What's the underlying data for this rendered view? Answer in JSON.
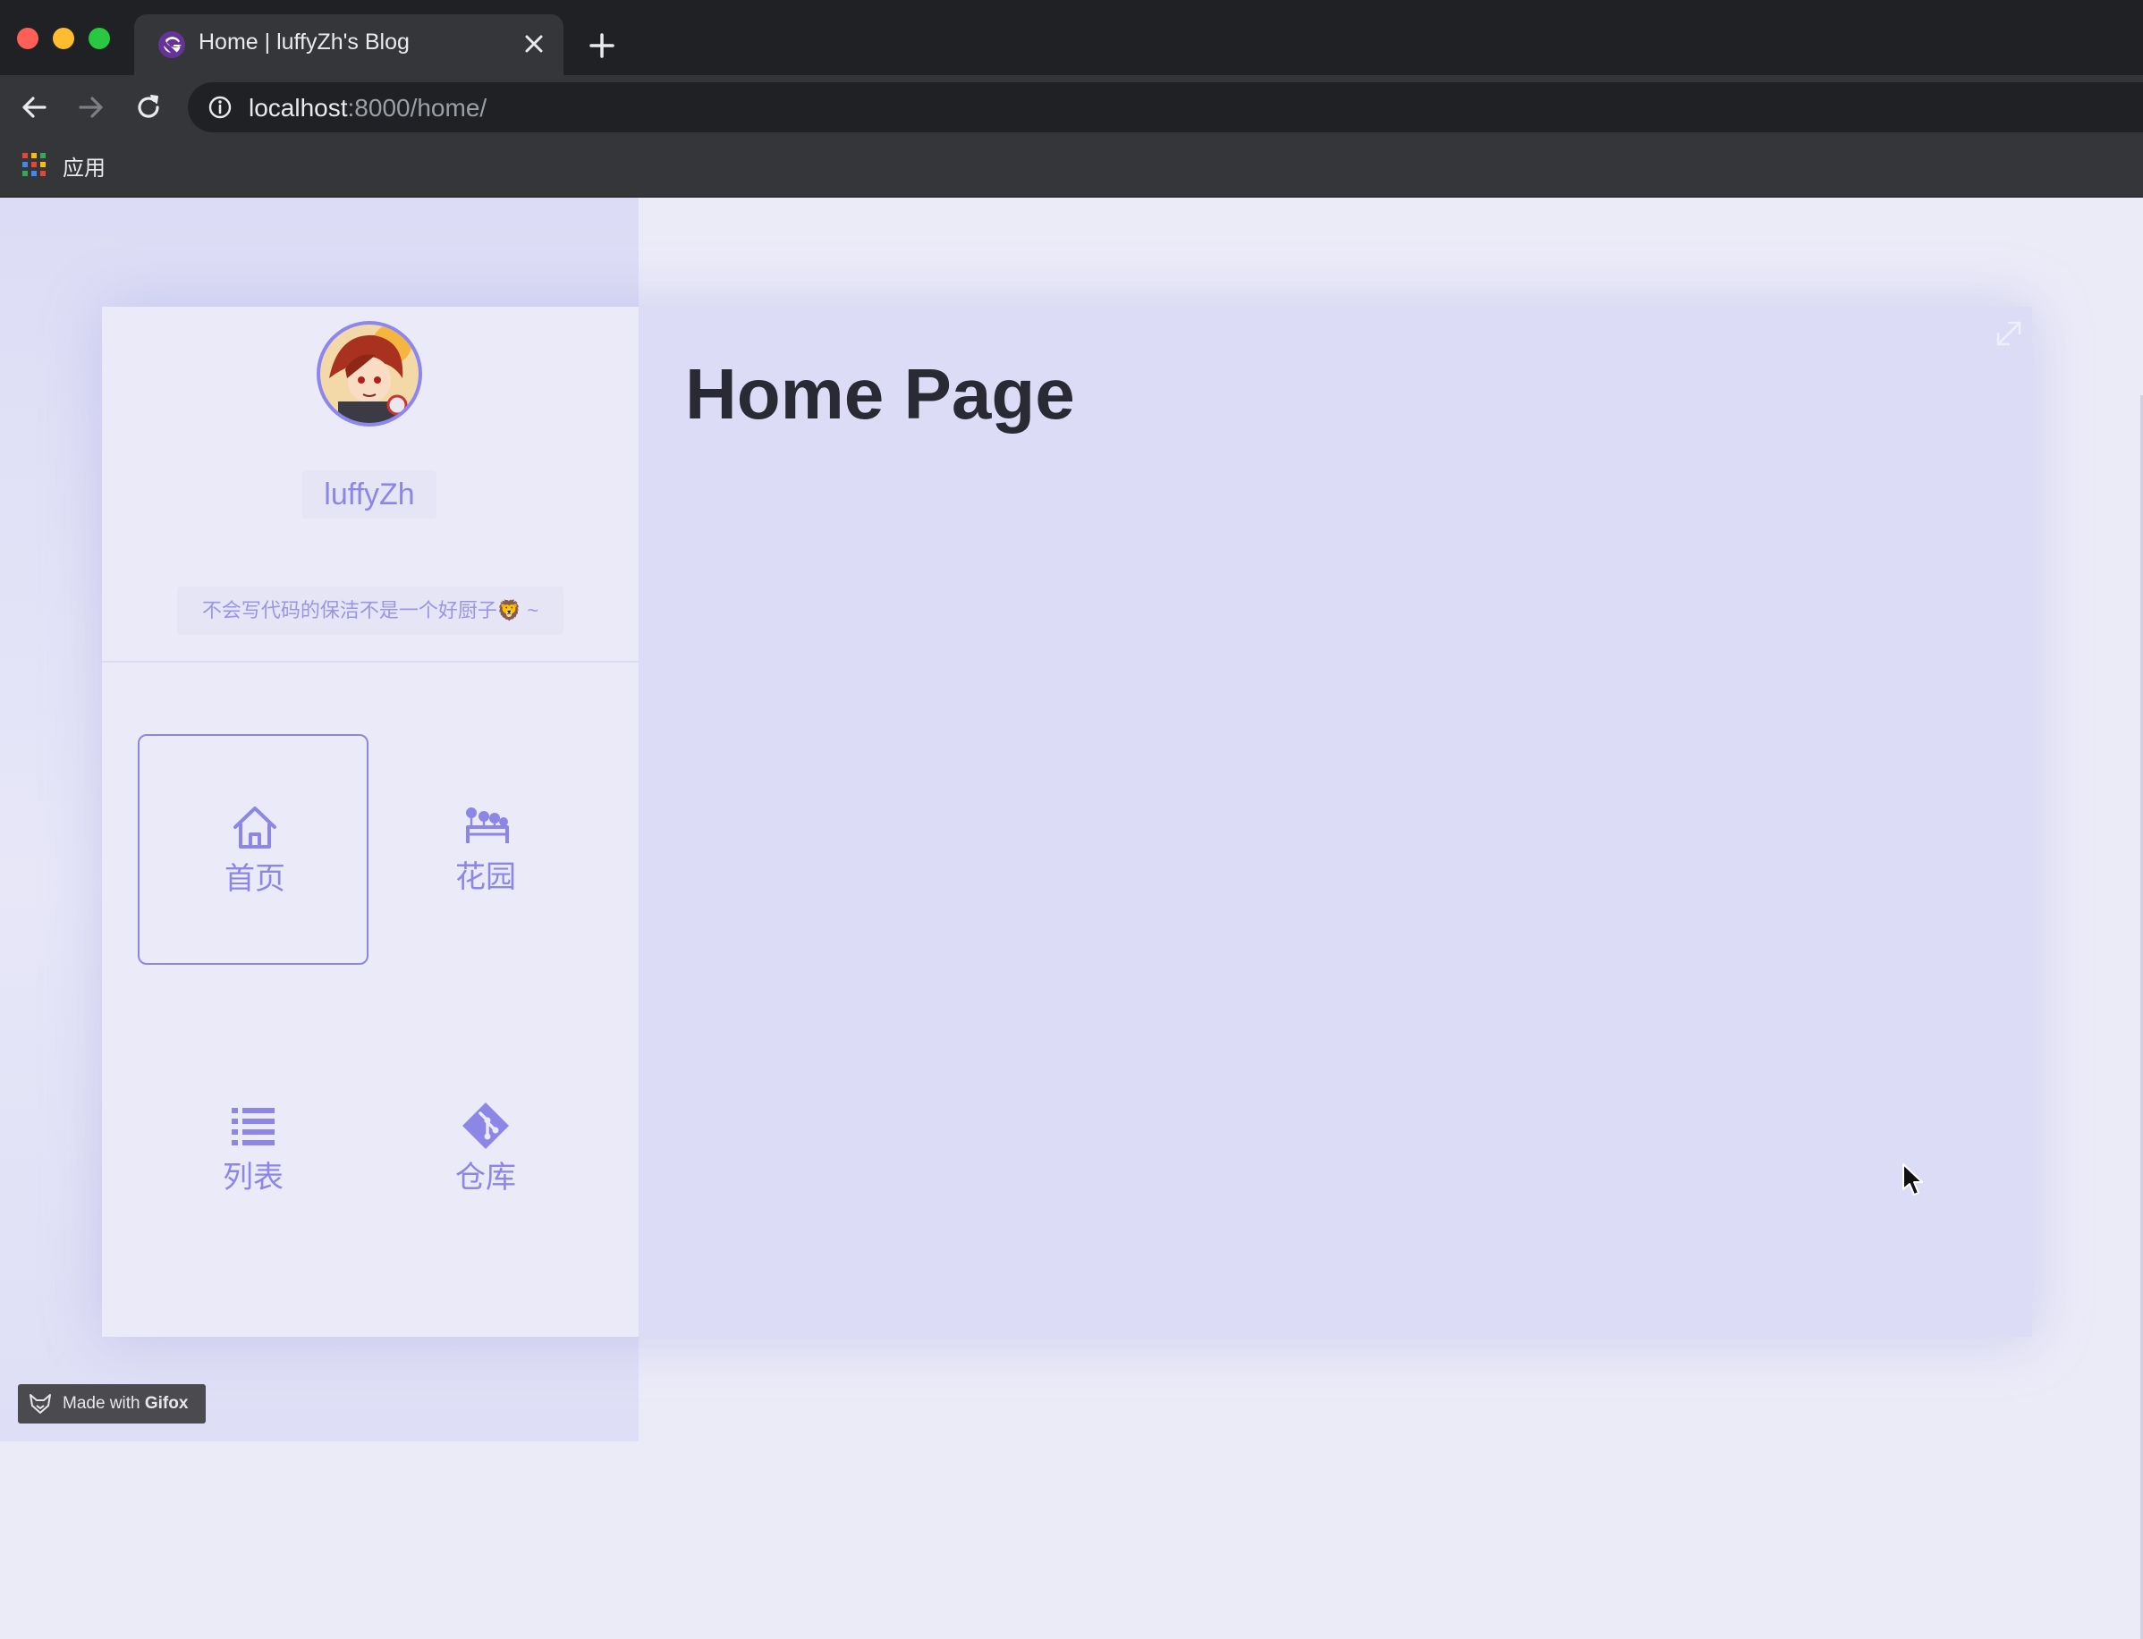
{
  "browser": {
    "tab_title": "Home | luffyZh's Blog",
    "url_host": "localhost",
    "url_path": ":8000/home/",
    "bookmark_apps_label": "应用"
  },
  "profile": {
    "username": "luffyZh",
    "bio": "不会写代码的保洁不是一个好厨子🦁 ~"
  },
  "nav": {
    "items": [
      {
        "label": "首页",
        "icon": "home-icon",
        "active": true
      },
      {
        "label": "花园",
        "icon": "garden-icon",
        "active": false
      },
      {
        "label": "列表",
        "icon": "list-icon",
        "active": false
      },
      {
        "label": "仓库",
        "icon": "git-repo-icon",
        "active": false
      }
    ]
  },
  "main": {
    "title": "Home Page"
  },
  "watermark": {
    "prefix": "Made with ",
    "brand": "Gifox"
  },
  "colors": {
    "accent": "#8c87e6",
    "sidebar_bg": "#eaeaf8",
    "main_bg": "#dcdcf6",
    "title_text": "#2a2a35",
    "chrome_dark": "#202124",
    "chrome_toolbar": "#35363a"
  }
}
